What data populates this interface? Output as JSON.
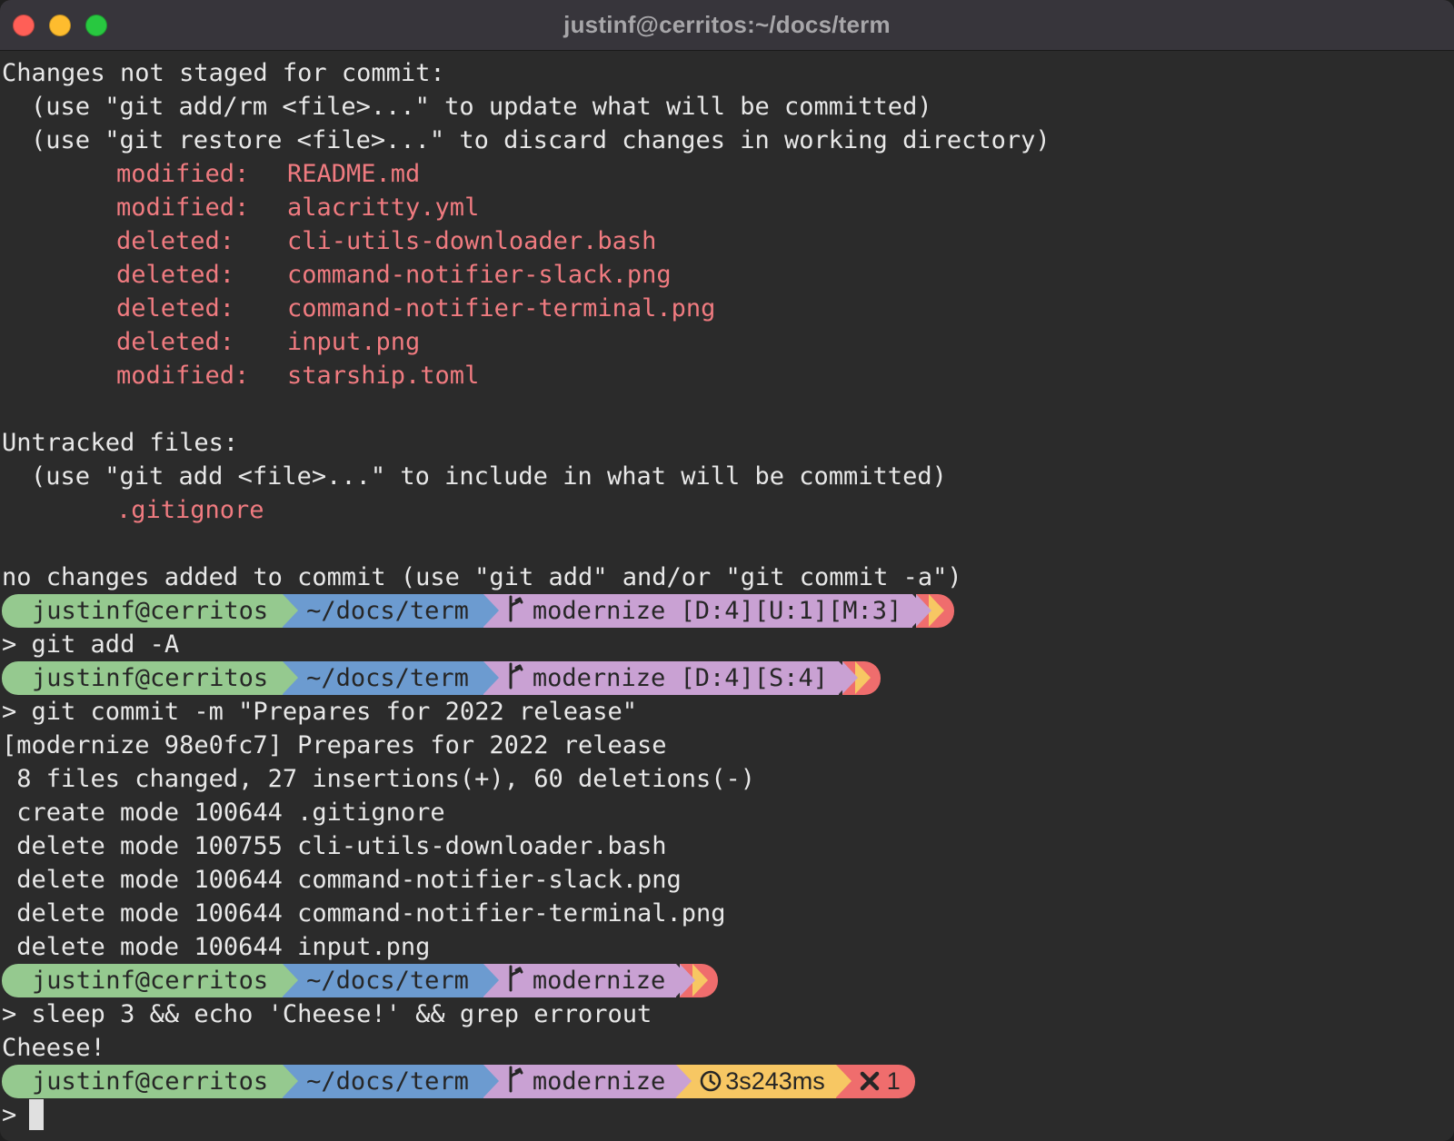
{
  "window": {
    "title": "justinf@cerritos:~/docs/term"
  },
  "status_output": {
    "header_unstaged": "Changes not staged for commit:",
    "hint_update": "(use \"git add/rm <file>...\" to update what will be committed)",
    "hint_restore": "(use \"git restore <file>...\" to discard changes in working directory)",
    "changes": [
      {
        "status": "modified:",
        "file": "README.md"
      },
      {
        "status": "modified:",
        "file": "alacritty.yml"
      },
      {
        "status": "deleted:",
        "file": "cli-utils-downloader.bash"
      },
      {
        "status": "deleted:",
        "file": "command-notifier-slack.png"
      },
      {
        "status": "deleted:",
        "file": "command-notifier-terminal.png"
      },
      {
        "status": "deleted:",
        "file": "input.png"
      },
      {
        "status": "modified:",
        "file": "starship.toml"
      }
    ],
    "header_untracked": "Untracked files:",
    "hint_include": "(use \"git add <file>...\" to include in what will be committed)",
    "untracked_file": ".gitignore",
    "summary": "no changes added to commit (use \"git add\" and/or \"git commit -a\")"
  },
  "prompts": [
    {
      "user": "justinf@cerritos",
      "dir": "~/docs/term",
      "branch": "modernize",
      "git_status": "[D:4][U:1][M:3]"
    },
    {
      "user": "justinf@cerritos",
      "dir": "~/docs/term",
      "branch": "modernize",
      "git_status": "[D:4][S:4]"
    },
    {
      "user": "justinf@cerritos",
      "dir": "~/docs/term",
      "branch": "modernize",
      "git_status": ""
    },
    {
      "user": "justinf@cerritos",
      "dir": "~/docs/term",
      "branch": "modernize",
      "duration": "3s243ms",
      "exit_code": "1"
    }
  ],
  "prompt_char": ">",
  "commands": {
    "add": "git add -A",
    "commit": "git commit -m \"Prepares for 2022 release\"",
    "sleep": "sleep 3 && echo 'Cheese!' && grep errorout"
  },
  "commit_output": [
    "[modernize 98e0fc7] Prepares for 2022 release",
    " 8 files changed, 27 insertions(+), 60 deletions(-)",
    " create mode 100644 .gitignore",
    " delete mode 100755 cli-utils-downloader.bash",
    " delete mode 100644 command-notifier-slack.png",
    " delete mode 100644 command-notifier-terminal.png",
    " delete mode 100644 input.png"
  ],
  "echo_output": "Cheese!",
  "colors": {
    "background": "#2b2b2b",
    "titlebar": "#37353b",
    "text": "#e8e8e8",
    "git_red": "#f07b80",
    "seg_user": "#95c98f",
    "seg_dir": "#6c9bd0",
    "seg_branch": "#c9a1d3",
    "seg_duration": "#f7c763",
    "seg_code": "#ef6d6d"
  },
  "icons": {
    "branch": "git-branch-icon",
    "duration": "clock-icon",
    "exit_code": "x-icon"
  }
}
